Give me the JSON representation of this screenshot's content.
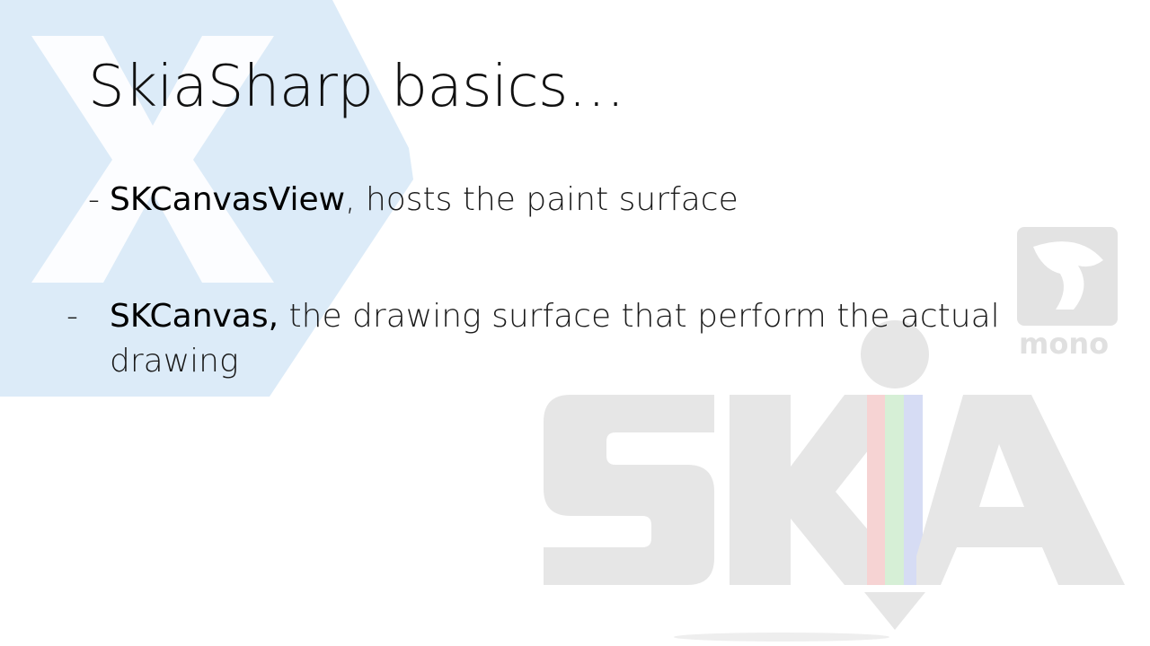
{
  "slide": {
    "title": "SkiaSharp basics…",
    "bullets": [
      {
        "dash": "-",
        "term": "SKCanvasView",
        "rest": ", hosts the paint surface"
      },
      {
        "dash": "-",
        "term": "SKCanvas,",
        "rest": " the drawing surface that perform the actual drawing"
      }
    ]
  },
  "decor": {
    "xamarin_logo_color": "#dcebf8",
    "skia_logo_color": "#e6e6e6",
    "mono_logo_text": "mono",
    "mono_logo_color": "#e0e0e0",
    "skia_logo_text": "SKIA",
    "skia_stripe_colors": [
      "#f6d3d3",
      "#d6efd6",
      "#d6dcf4"
    ]
  }
}
